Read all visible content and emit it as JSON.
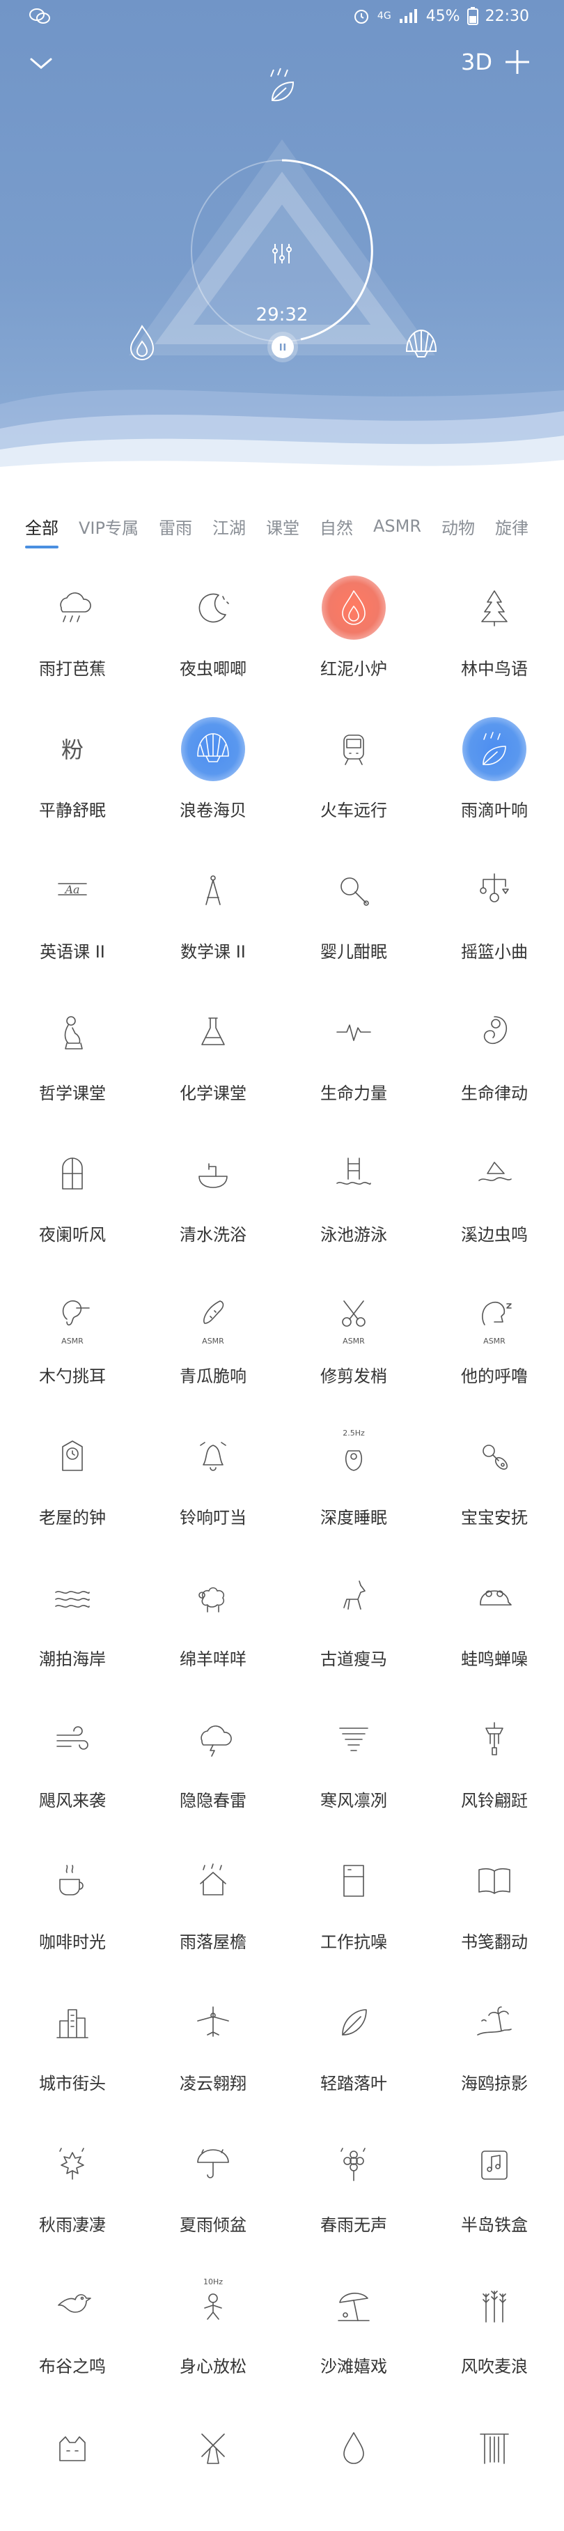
{
  "status": {
    "network": "4G",
    "battery": "45%",
    "time": "22:30"
  },
  "player": {
    "timer": "29:32",
    "mode_3d": "3D"
  },
  "tabs": [
    "全部",
    "VIP专属",
    "雷雨",
    "江湖",
    "课堂",
    "自然",
    "ASMR",
    "动物",
    "旋律"
  ],
  "active_tab": 0,
  "sounds": [
    {
      "label": "雨打芭蕉",
      "icon": "cloud-rain-icon",
      "style": "plain"
    },
    {
      "label": "夜虫唧唧",
      "icon": "moon-stars-icon",
      "style": "plain"
    },
    {
      "label": "红泥小炉",
      "icon": "flame-icon",
      "style": "red"
    },
    {
      "label": "林中鸟语",
      "icon": "pine-tree-icon",
      "style": "plain"
    },
    {
      "label": "平静舒眠",
      "icon": "powder-character-icon",
      "style": "plain"
    },
    {
      "label": "浪卷海贝",
      "icon": "shell-icon",
      "style": "blue"
    },
    {
      "label": "火车远行",
      "icon": "train-icon",
      "style": "plain"
    },
    {
      "label": "雨滴叶响",
      "icon": "leaf-rain-icon",
      "style": "blue"
    },
    {
      "label": "英语课 II",
      "icon": "letters-icon",
      "style": "plain"
    },
    {
      "label": "数学课 II",
      "icon": "compass-tool-icon",
      "style": "plain"
    },
    {
      "label": "婴儿酣眠",
      "icon": "rattle-icon",
      "style": "plain"
    },
    {
      "label": "摇篮小曲",
      "icon": "mobile-toy-icon",
      "style": "plain"
    },
    {
      "label": "哲学课堂",
      "icon": "thinker-icon",
      "style": "plain"
    },
    {
      "label": "化学课堂",
      "icon": "flask-icon",
      "style": "plain"
    },
    {
      "label": "生命力量",
      "icon": "heartbeat-icon",
      "style": "plain"
    },
    {
      "label": "生命律动",
      "icon": "fetus-icon",
      "style": "plain"
    },
    {
      "label": "夜阑听风",
      "icon": "window-icon",
      "style": "plain"
    },
    {
      "label": "清水洗浴",
      "icon": "basin-tap-icon",
      "style": "plain"
    },
    {
      "label": "泳池游泳",
      "icon": "pool-ladder-icon",
      "style": "plain"
    },
    {
      "label": "溪边虫鸣",
      "icon": "stream-icon",
      "style": "plain"
    },
    {
      "label": "木勺挑耳",
      "icon": "ear-asmr-icon",
      "style": "plain",
      "caption": "ASMR"
    },
    {
      "label": "青瓜脆响",
      "icon": "cucumber-asmr-icon",
      "style": "plain",
      "caption": "ASMR"
    },
    {
      "label": "修剪发梢",
      "icon": "scissors-asmr-icon",
      "style": "plain",
      "caption": "ASMR"
    },
    {
      "label": "他的呼噜",
      "icon": "snore-asmr-icon",
      "style": "plain",
      "caption": "ASMR"
    },
    {
      "label": "老屋的钟",
      "icon": "clock-icon",
      "style": "plain"
    },
    {
      "label": "铃响叮当",
      "icon": "bell-icon",
      "style": "plain"
    },
    {
      "label": "深度睡眠",
      "icon": "deep-sleep-icon",
      "style": "plain",
      "caption": "2.5Hz"
    },
    {
      "label": "宝宝安抚",
      "icon": "pacifier-icon",
      "style": "plain"
    },
    {
      "label": "潮拍海岸",
      "icon": "waves-icon",
      "style": "plain"
    },
    {
      "label": "绵羊咩咩",
      "icon": "sheep-icon",
      "style": "plain"
    },
    {
      "label": "古道瘦马",
      "icon": "horse-icon",
      "style": "plain"
    },
    {
      "label": "蛙鸣蝉噪",
      "icon": "frog-icon",
      "style": "plain"
    },
    {
      "label": "飓风来袭",
      "icon": "wind-icon",
      "style": "plain"
    },
    {
      "label": "隐隐春雷",
      "icon": "thunder-cloud-icon",
      "style": "plain"
    },
    {
      "label": "寒风凛冽",
      "icon": "cold-wind-icon",
      "style": "plain"
    },
    {
      "label": "风铃翩跹",
      "icon": "wind-chime-icon",
      "style": "plain"
    },
    {
      "label": "咖啡时光",
      "icon": "coffee-icon",
      "style": "plain"
    },
    {
      "label": "雨落屋檐",
      "icon": "house-rain-icon",
      "style": "plain"
    },
    {
      "label": "工作抗噪",
      "icon": "office-icon",
      "style": "plain"
    },
    {
      "label": "书笺翻动",
      "icon": "book-icon",
      "style": "plain"
    },
    {
      "label": "城市街头",
      "icon": "city-icon",
      "style": "plain"
    },
    {
      "label": "凌云翱翔",
      "icon": "plane-icon",
      "style": "plain"
    },
    {
      "label": "轻踏落叶",
      "icon": "leaf-icon",
      "style": "plain"
    },
    {
      "label": "海鸥掠影",
      "icon": "beach-icon",
      "style": "plain"
    },
    {
      "label": "秋雨凄凄",
      "icon": "maple-rain-icon",
      "style": "plain"
    },
    {
      "label": "夏雨倾盆",
      "icon": "umbrella-rain-icon",
      "style": "plain"
    },
    {
      "label": "春雨无声",
      "icon": "flower-rain-icon",
      "style": "plain"
    },
    {
      "label": "半岛铁盒",
      "icon": "music-box-icon",
      "style": "plain"
    },
    {
      "label": "布谷之鸣",
      "icon": "bird-icon",
      "style": "plain"
    },
    {
      "label": "身心放松",
      "icon": "relax-icon",
      "style": "plain",
      "caption": "10Hz"
    },
    {
      "label": "沙滩嬉戏",
      "icon": "beach-umbrella-icon",
      "style": "plain"
    },
    {
      "label": "风吹麦浪",
      "icon": "wheat-icon",
      "style": "plain"
    },
    {
      "label": "",
      "icon": "sleeping-cat-icon",
      "style": "plain"
    },
    {
      "label": "",
      "icon": "windmill-icon",
      "style": "plain"
    },
    {
      "label": "",
      "icon": "water-drop-icon",
      "style": "plain"
    },
    {
      "label": "",
      "icon": "waterfall-icon",
      "style": "plain"
    }
  ]
}
